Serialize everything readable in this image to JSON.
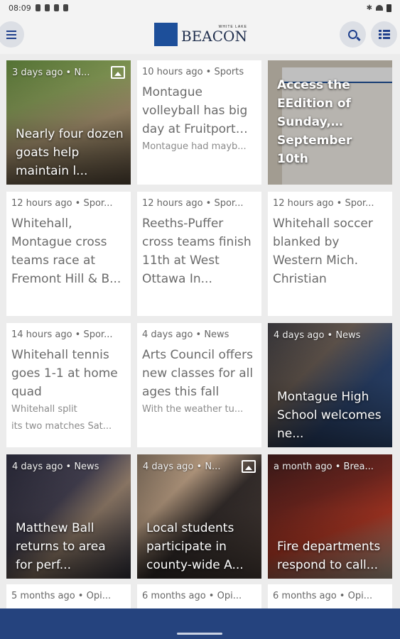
{
  "status": {
    "time": "08:09"
  },
  "logo": {
    "box": "WHITE LAKE",
    "small": "WHITE LAKE",
    "name": "BEACON"
  },
  "cards": [
    {
      "meta": "3 days ago • N...",
      "title": "Nearly four dozen goats help maintain l...",
      "gallery": true
    },
    {
      "meta": "10 hours ago • Sports",
      "title": "Montague volleyball has big day at Fruitport Invitational",
      "excerpt": "Montague had mayb..."
    },
    {
      "meta": "",
      "title": "Access the EEdition of Sunday, September 10th"
    },
    {
      "meta": "12 hours ago • Spor...",
      "title": "Whitehall, Montague cross teams race at Fremont Hill & B..."
    },
    {
      "meta": "12 hours ago • Spor...",
      "title": "Reeths-Puffer cross teams finish 11th at West Ottawa In..."
    },
    {
      "meta": "12 hours ago • Spor...",
      "title": "Whitehall soccer blanked by Western Mich. Christian"
    },
    {
      "meta": "14 hours ago • Spor...",
      "title": "Whitehall tennis goes 1-1 at home quad",
      "excerpt": "Whitehall split",
      "excerpt2": "its two matches Sat..."
    },
    {
      "meta": "4 days ago • News",
      "title": "Arts Council offers new classes for all ages this fall",
      "excerpt": "With the weather tu..."
    },
    {
      "meta": "4 days ago • News",
      "title": "Montague High School welcomes ne..."
    },
    {
      "meta": "4 days ago • News",
      "title": "Matthew Ball returns to area for perf..."
    },
    {
      "meta": "4 days ago • N...",
      "title": "Local students participate in county-wide A...",
      "gallery": true
    },
    {
      "meta": "a month ago • Brea...",
      "title": "Fire departments respond to call..."
    },
    {
      "meta": "5 months ago • Opi..."
    },
    {
      "meta": "6 months ago • Opi..."
    },
    {
      "meta": "6 months ago • Opi..."
    }
  ]
}
